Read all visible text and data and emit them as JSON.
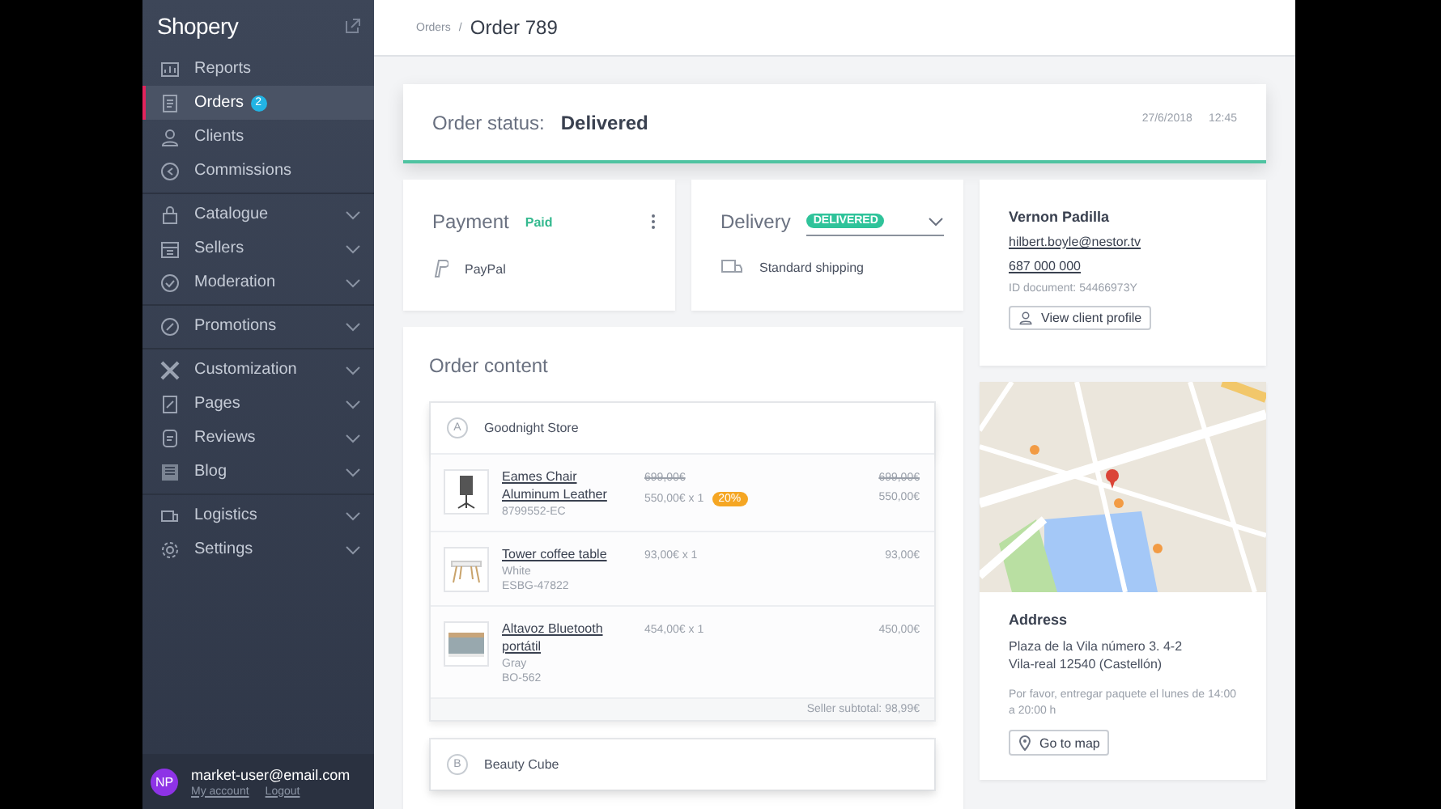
{
  "sidebar": {
    "brand": "Shopery",
    "sections": [
      {
        "items": [
          {
            "label": "Reports",
            "kind": "link",
            "selected": false
          },
          {
            "label": "Orders",
            "kind": "link",
            "selected": true,
            "badge": "2"
          },
          {
            "label": "Clients",
            "kind": "link",
            "selected": false
          },
          {
            "label": "Commissions",
            "kind": "link",
            "selected": false
          }
        ]
      },
      {
        "items": [
          {
            "label": "Catalogue",
            "kind": "menu",
            "selected": false
          },
          {
            "label": "Sellers",
            "kind": "menu",
            "selected": false
          },
          {
            "label": "Moderation",
            "kind": "menu",
            "selected": false
          }
        ]
      },
      {
        "items": [
          {
            "label": "Promotions",
            "kind": "menu",
            "selected": false
          }
        ]
      },
      {
        "items": [
          {
            "label": "Customization",
            "kind": "menu",
            "selected": false
          },
          {
            "label": "Pages",
            "kind": "menu",
            "selected": false
          },
          {
            "label": "Reviews",
            "kind": "menu",
            "selected": false
          },
          {
            "label": "Blog",
            "kind": "menu",
            "selected": false
          }
        ]
      },
      {
        "items": [
          {
            "label": "Logistics",
            "kind": "menu",
            "selected": false
          },
          {
            "label": "Settings",
            "kind": "menu",
            "selected": false
          }
        ]
      }
    ],
    "user": {
      "initials": "NP",
      "email": "market-user@email.com",
      "links": [
        "My account",
        "Logout"
      ]
    }
  },
  "header": {
    "parent": "Orders",
    "separator": "/",
    "title": "Order 789"
  },
  "status": {
    "label": "Order status:",
    "value": "Delivered",
    "date": "27/6/2018",
    "time": "12:45"
  },
  "payment": {
    "title": "Payment",
    "status": "Paid",
    "method": "PayPal"
  },
  "delivery": {
    "title": "Delivery",
    "status": "DELIVERED",
    "method": "Standard shipping"
  },
  "client": {
    "name": "Vernon Padilla",
    "email": "hilbert.boyle@nestor.tv",
    "phone": "687 000 000",
    "id_document": "ID document: 54466973Y",
    "button": "View client profile"
  },
  "order_content": {
    "title": "Order content",
    "stores": [
      {
        "letter": "A",
        "name": "Goodnight Store",
        "products": [
          {
            "kind": "chair",
            "name": "Eames Chair Aluminum Leather",
            "sku": "8799552-EC",
            "old_price": "699,00€",
            "price": "550,00€ x 1",
            "discount": "20%",
            "old_total": "699,00€",
            "total": "550,00€"
          },
          {
            "kind": "table",
            "name": "Tower coffee table",
            "variant": "White",
            "sku": "ESBG-47822",
            "price": "93,00€ x 1",
            "total": "93,00€"
          },
          {
            "kind": "speaker",
            "name": "Altavoz Bluetooth portátil",
            "variant": "Gray",
            "sku": "BO-562",
            "price": "454,00€ x 1",
            "total": "450,00€"
          }
        ],
        "subtotal": "Seller subtotal: 98,99€"
      },
      {
        "letter": "B",
        "name": "Beauty Cube"
      }
    ]
  },
  "address": {
    "title": "Address",
    "lines": [
      "Plaza de la Vila número 3. 4-2",
      "Vila-real 12540 (Castellón)"
    ],
    "note": "Por favor, entregar paquete el lunes de 14:00 a 20:00 h",
    "button": "Go to map"
  }
}
